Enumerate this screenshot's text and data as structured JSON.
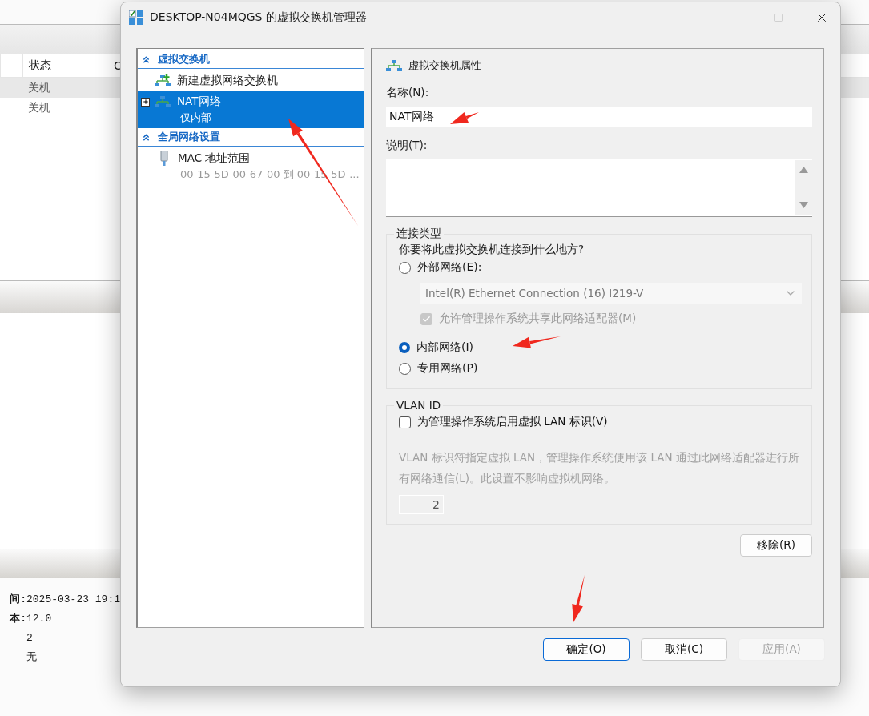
{
  "background_app": {
    "columns": [
      "状态",
      "C"
    ],
    "rows": [
      {
        "status": "关机",
        "selected": true
      },
      {
        "status": "关机",
        "selected": false
      }
    ],
    "details": [
      {
        "label": "间:",
        "value": "2025-03-23 19:1"
      },
      {
        "label": "本:",
        "value": "12.0"
      },
      {
        "value": "2"
      },
      {
        "value": "无"
      }
    ]
  },
  "dialog": {
    "title": "DESKTOP-N04MQGS 的虚拟交换机管理器",
    "tree": [
      {
        "title": "虚拟交换机",
        "items": [
          {
            "kind": "new",
            "label": "新建虚拟网络交换机",
            "selected": false
          },
          {
            "kind": "switch",
            "label": "NAT网络",
            "subtitle": "仅内部",
            "selected": true,
            "expanded": false
          }
        ]
      },
      {
        "title": "全局网络设置",
        "items": [
          {
            "kind": "mac",
            "label": "MAC 地址范围",
            "subtitle": "00-15-5D-00-67-00 到 00-15-5D-...",
            "selected": false
          }
        ]
      }
    ],
    "properties": {
      "heading": "虚拟交换机属性",
      "name_label": "名称(N):",
      "name_value": "NAT网络",
      "description_label": "说明(T):",
      "connection": {
        "title": "连接类型",
        "question": "你要将此虚拟交换机连接到什么地方?",
        "options": [
          {
            "label": "外部网络(E):",
            "selected": false
          },
          {
            "label": "内部网络(I)",
            "selected": true
          },
          {
            "label": "专用网络(P)",
            "selected": false
          }
        ],
        "adapter": {
          "value": "Intel(R) Ethernet Connection (16) I219-V",
          "disabled": true
        },
        "share": {
          "label": "允许管理操作系统共享此网络适配器(M)",
          "checked": true,
          "disabled": true
        }
      },
      "vlan": {
        "title": "VLAN ID",
        "checkbox": {
          "label": "为管理操作系统启用虚拟 LAN 标识(V)",
          "checked": false
        },
        "note": "VLAN 标识符指定虚拟 LAN，管理操作系统使用该 LAN 通过此网络适配器进行所有网络通信(L)。此设置不影响虚拟机网络。",
        "value": "2",
        "disabled": true
      },
      "remove_button": "移除(R)"
    },
    "buttons": [
      {
        "label": "确定(O)",
        "kind": "default"
      },
      {
        "label": "取消(C)",
        "kind": "normal"
      },
      {
        "label": "应用(A)",
        "kind": "disabled"
      }
    ]
  }
}
